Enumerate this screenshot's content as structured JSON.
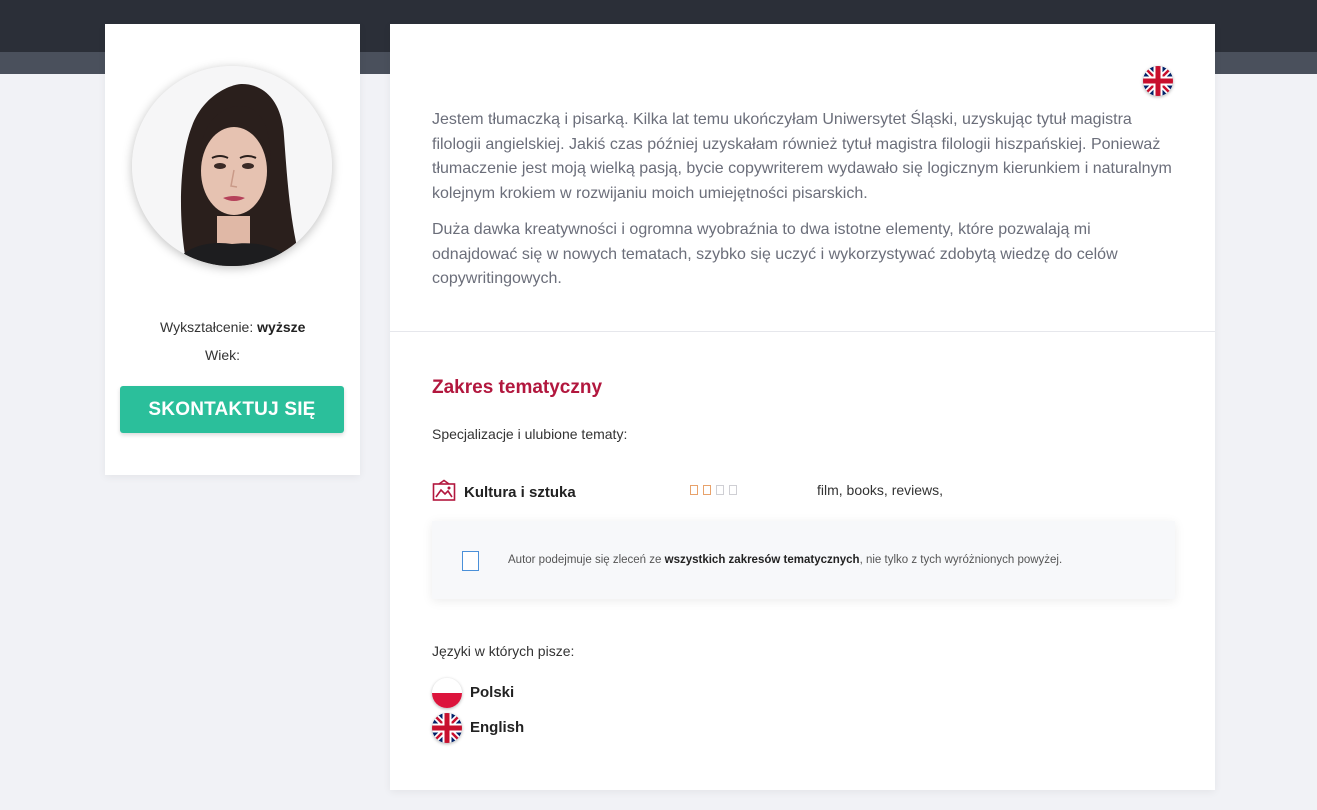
{
  "profile": {
    "avatar_alt": "profile photo",
    "education_label": "Wykształcenie:",
    "education_value": "wyższe",
    "age_label": "Wiek:",
    "age_value": "",
    "contact_button": "SKONTAKTUJ SIĘ"
  },
  "bio": {
    "paragraph_1": "Jestem tłumaczką i pisarką. Kilka lat temu ukończyłam Uniwersytet Śląski, uzyskując tytuł magistra filologii angielskiej. Jakiś czas później uzyskałam również tytuł magistra filologii hiszpańskiej. Ponieważ tłumaczenie jest moją wielką pasją, bycie copywriterem wydawało się logicznym kierunkiem i naturalnym kolejnym krokiem w rozwijaniu moich umiejętności pisarskich.",
    "paragraph_2": "Duża dawka kreatywności i ogromna wyobraźnia to dwa istotne elementy, które pozwalają mi odnajdować się w nowych tematach, szybko się uczyć i wykorzystywać zdobytą wiedzę do celów copywritingowych."
  },
  "topics": {
    "title": "Zakres tematyczny",
    "subtitle": "Specjalizacje i ulubione tematy:",
    "items": [
      {
        "name": "Kultura i sztuka",
        "rating": 2,
        "rating_max": 4,
        "tags": "film, books, reviews,"
      }
    ],
    "notice_prefix": "Autor podejmuje się zleceń ze ",
    "notice_bold": "wszystkich zakresów tematycznych",
    "notice_suffix": ", nie tylko z tych wyróżnionych powyżej."
  },
  "languages": {
    "title": "Języki w których pisze:",
    "items": [
      {
        "name": "Polski",
        "flag": "pl-flag-icon"
      },
      {
        "name": "English",
        "flag": "uk-flag-icon"
      }
    ]
  },
  "colors": {
    "accent": "#b2173e",
    "button": "#2bbf9b",
    "header_dark": "#2b2f38",
    "star_active": "#e8a26b"
  }
}
